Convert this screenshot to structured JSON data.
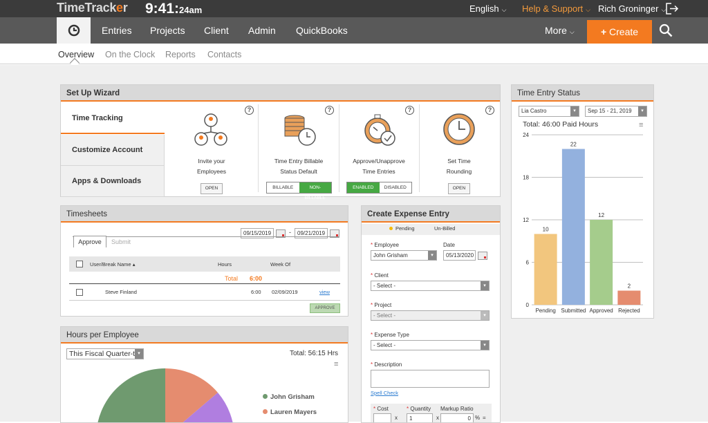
{
  "topbar": {
    "logo_a": "TimeTrack",
    "logo_o": "e",
    "logo_b": "r",
    "clock_time": "9:41:",
    "clock_secs": "24am",
    "language": "English",
    "help": "Help & Support",
    "user": "Rich Groninger"
  },
  "nav": {
    "items": [
      "Entries",
      "Projects",
      "Client",
      "Admin",
      "QuickBooks"
    ],
    "more": "More",
    "create": "Create"
  },
  "subnav": [
    "Overview",
    "On the Clock",
    "Reports",
    "Contacts"
  ],
  "wizard": {
    "title": "Set Up Wizard",
    "tabs": [
      "Time Tracking",
      "Customize Account",
      "Apps & Downloads"
    ],
    "steps": [
      {
        "title1": "Invite your",
        "title2": "Employees",
        "button": "OPEN"
      },
      {
        "title1": "Time Entry Billable",
        "title2": "Status Default",
        "toggle": [
          "BILLABLE",
          "NON-BILLABLE"
        ]
      },
      {
        "title1": "Approve/Unapprove",
        "title2": "Time Entries",
        "toggle": [
          "ENABLED",
          "DISABLED"
        ]
      },
      {
        "title1": "Set Time",
        "title2": "Rounding",
        "button": "OPEN"
      }
    ]
  },
  "timesheets": {
    "title": "Timesheets",
    "date_from": "09/15/2019",
    "date_to": "09/21/2019",
    "sep": "-",
    "tabs": [
      "Approve",
      "Submit"
    ],
    "headers": [
      "User/Break Name",
      "Hours",
      "Week Of"
    ],
    "total_label": "Total",
    "total_value": "6:00",
    "row": {
      "name": "Steve Finland",
      "hours": "6:00",
      "week": "02/09/2019",
      "link": "view"
    },
    "approve": "APPROVE"
  },
  "hours_emp": {
    "title": "Hours per Employee",
    "period": "This Fiscal Quarter-t",
    "total": "Total: 56:15 Hrs",
    "legend": [
      {
        "name": "John Grisham",
        "color": "#6f9a6f"
      },
      {
        "name": "Lauren Mayers",
        "color": "#e58c6f"
      }
    ]
  },
  "expense": {
    "title": "Create Expense Entry",
    "legend": [
      "Pending",
      "Un-Billed"
    ],
    "employee_label": "Employee",
    "employee": "John Grisham",
    "date_label": "Date",
    "date": "05/13/2020",
    "client_label": "Client",
    "project_label": "Project",
    "expense_type_label": "Expense Type",
    "select": "- Select -",
    "description_label": "Description",
    "spell": "Spell Check",
    "cost_label": "Cost",
    "quantity_label": "Quantity",
    "quantity": "1",
    "markup_label": "Markup Ratio",
    "markup": "0",
    "pct": "%",
    "x": "x",
    "eq": "="
  },
  "status": {
    "title": "Time Entry Status",
    "user": "Lia Castro",
    "week": "Sep 15 - 21, 2019",
    "total": "Total: 46:00 Paid Hours"
  },
  "chart_data": {
    "type": "bar",
    "categories": [
      "Pending",
      "Submitted",
      "Approved",
      "Rejected"
    ],
    "values": [
      10,
      22,
      12,
      2
    ],
    "colors": [
      "#f2c67e",
      "#93b1de",
      "#a5cc8c",
      "#e58c6f"
    ],
    "yticks": [
      0,
      6,
      12,
      18,
      24
    ],
    "ylim": [
      0,
      24
    ]
  }
}
